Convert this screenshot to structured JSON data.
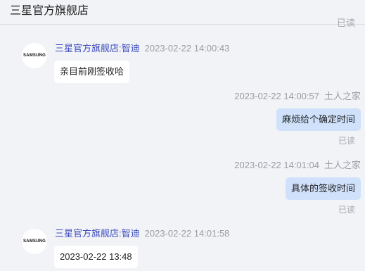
{
  "header": {
    "title": "三星官方旗舰店"
  },
  "read_label": "已读",
  "messages": [
    {
      "side": "left",
      "avatar_text": "SAMSUNG",
      "sender": "三星官方旗舰店:智迪",
      "time": "2023-02-22 14:00:43",
      "text": "亲目前刚签收哈"
    },
    {
      "side": "right",
      "sender": "土人之家",
      "time": "2023-02-22 14:00:57",
      "text": "麻烦给个确定时间",
      "read": "已读"
    },
    {
      "side": "right",
      "sender": "土人之家",
      "time": "2023-02-22 14:01:04",
      "text": "具体的签收时间",
      "read": "已读"
    },
    {
      "side": "left",
      "avatar_text": "SAMSUNG",
      "sender": "三星官方旗舰店:智迪",
      "time": "2023-02-22 14:01:58",
      "text": "2023-02-22 13:48"
    }
  ]
}
